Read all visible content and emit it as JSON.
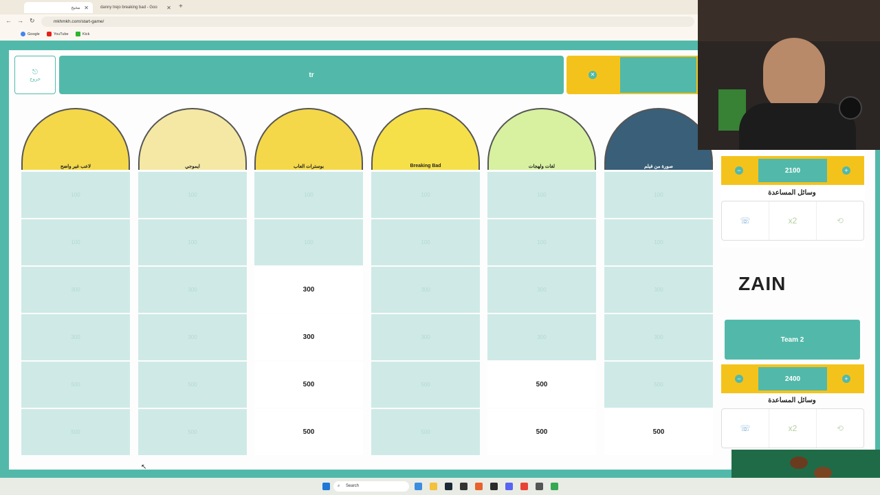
{
  "browser": {
    "tabs": [
      {
        "label": "مخيخ",
        "active": true
      },
      {
        "label": "danny trejo breaking bad - Goo",
        "active": false
      }
    ],
    "new_tab_icon": "plus-icon",
    "url": "mkhmkh.com/start-game/",
    "bookmarks": [
      "Google",
      "YouTube",
      "Kick"
    ]
  },
  "game": {
    "exit_label": "خروج",
    "banner_text": "tr",
    "categories": [
      {
        "label": "لاعب غير واضح",
        "color": "#f4d84a"
      },
      {
        "label": "ايموجي",
        "color": "#f4e8a4"
      },
      {
        "label": "بوسترات العاب",
        "color": "#f4d84a"
      },
      {
        "label": "Breaking Bad",
        "color": "#f6e04a"
      },
      {
        "label": "لغات ولهجات",
        "color": "#d7f1a0"
      },
      {
        "label": "صورة من فيلم",
        "color": "#3a5f78"
      }
    ],
    "rows": [
      [
        {
          "v": "100",
          "open": false
        },
        {
          "v": "100",
          "open": false
        },
        {
          "v": "100",
          "open": false
        },
        {
          "v": "100",
          "open": false
        },
        {
          "v": "100",
          "open": false
        },
        {
          "v": "100",
          "open": false
        }
      ],
      [
        {
          "v": "100",
          "open": false
        },
        {
          "v": "100",
          "open": false
        },
        {
          "v": "100",
          "open": false
        },
        {
          "v": "100",
          "open": false
        },
        {
          "v": "100",
          "open": false
        },
        {
          "v": "100",
          "open": false
        }
      ],
      [
        {
          "v": "300",
          "open": false
        },
        {
          "v": "300",
          "open": false
        },
        {
          "v": "300",
          "open": true
        },
        {
          "v": "300",
          "open": false
        },
        {
          "v": "300",
          "open": false
        },
        {
          "v": "300",
          "open": false
        }
      ],
      [
        {
          "v": "300",
          "open": false
        },
        {
          "v": "300",
          "open": false
        },
        {
          "v": "300",
          "open": true
        },
        {
          "v": "300",
          "open": false
        },
        {
          "v": "300",
          "open": false
        },
        {
          "v": "300",
          "open": false
        }
      ],
      [
        {
          "v": "500",
          "open": false
        },
        {
          "v": "500",
          "open": false
        },
        {
          "v": "500",
          "open": true
        },
        {
          "v": "500",
          "open": false
        },
        {
          "v": "500",
          "open": true
        },
        {
          "v": "500",
          "open": false
        }
      ],
      [
        {
          "v": "500",
          "open": false
        },
        {
          "v": "500",
          "open": false
        },
        {
          "v": "500",
          "open": true
        },
        {
          "v": "500",
          "open": false
        },
        {
          "v": "500",
          "open": true
        },
        {
          "v": "500",
          "open": true
        }
      ]
    ],
    "team1": {
      "score": "2100",
      "helpers_title": "وسائل المساعدة"
    },
    "sponsor": "ZAIN",
    "team2": {
      "name": "Team 2",
      "score": "2400",
      "helpers_title": "وسائل المساعدة"
    },
    "helper_icons": [
      "phone-icon",
      "double-x2-icon",
      "swap-icon"
    ]
  },
  "taskbar": {
    "search_placeholder": "Search"
  },
  "colors": {
    "accent": "#52b9aa",
    "yellow": "#f4c31b",
    "closed_cell": "#cfeae6"
  }
}
